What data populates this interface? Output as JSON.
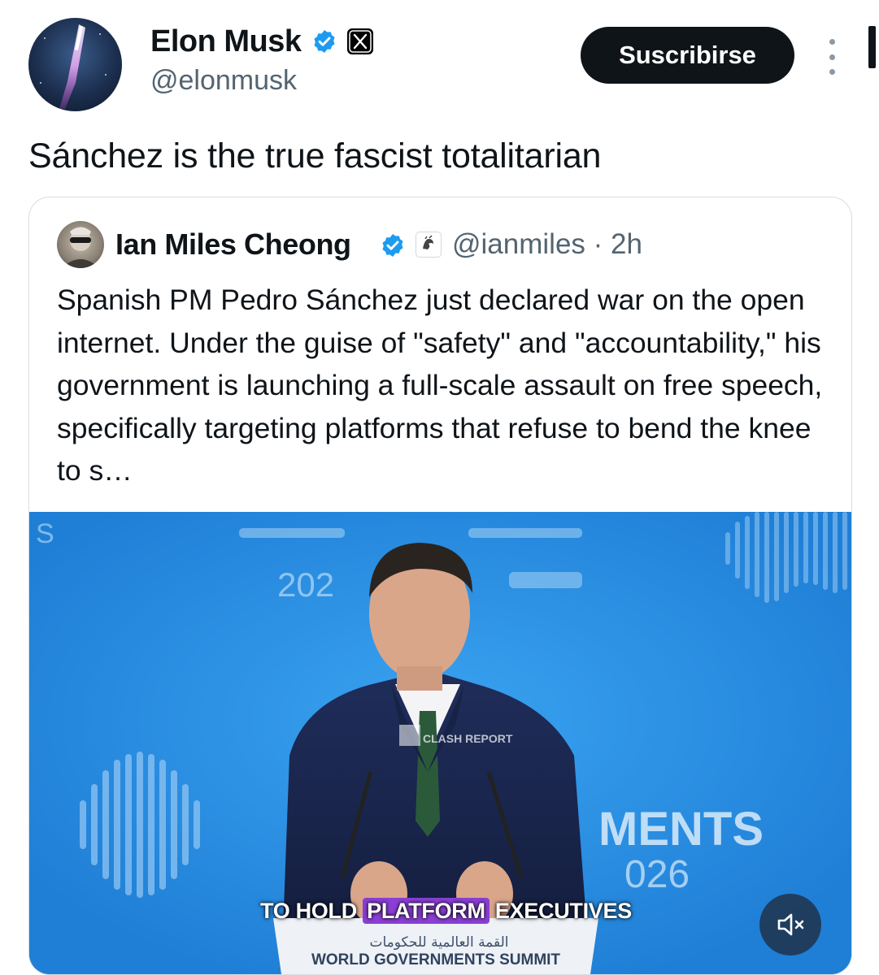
{
  "author": {
    "display_name": "Elon Musk",
    "handle": "@elonmusk",
    "avatar_icon": "rocket-avatar-icon",
    "verified_icon": "verified-badge-icon",
    "affiliation_icon": "x-logo-icon"
  },
  "actions": {
    "subscribe_label": "Suscribirse",
    "more_icon": "more-vertical-icon"
  },
  "tweet": {
    "text": "Sánchez is the true fascist totalitarian"
  },
  "quoted_tweet": {
    "display_name": "Ian Miles Cheong",
    "handle": "@ianmiles",
    "time": " · 2h",
    "verified_icon": "verified-badge-icon",
    "affiliation_icon": "affiliate-logo-icon",
    "text": "Spanish PM Pedro Sánchez just declared war on the open internet. Under the guise of \"safety\" and \"accountability,\" his government is launching a full-scale assault on free speech, specifically targeting platforms that refuse to bend the knee to s…",
    "media": {
      "type": "video",
      "backdrop_year": "2026",
      "backdrop_year_partial": "202",
      "backdrop_word_partial": "MENTS",
      "backdrop_year_right_partial": "026",
      "watermark": "CLASH REPORT",
      "caption_before": "TO HOLD ",
      "caption_highlight": "PLATFORM",
      "caption_after": " EXECUTIVES",
      "podium_arabic": "القمة العالمية للحكومات",
      "podium_english": "WORLD GOVERNMENTS SUMMIT",
      "mute_icon": "volume-muted-icon"
    }
  },
  "colors": {
    "accent_verified": "#1d9bf0",
    "text_primary": "#0f1419",
    "text_secondary": "#536471",
    "caption_highlight": "#8b3fd6",
    "stage_blue": "#2b8fe0"
  }
}
